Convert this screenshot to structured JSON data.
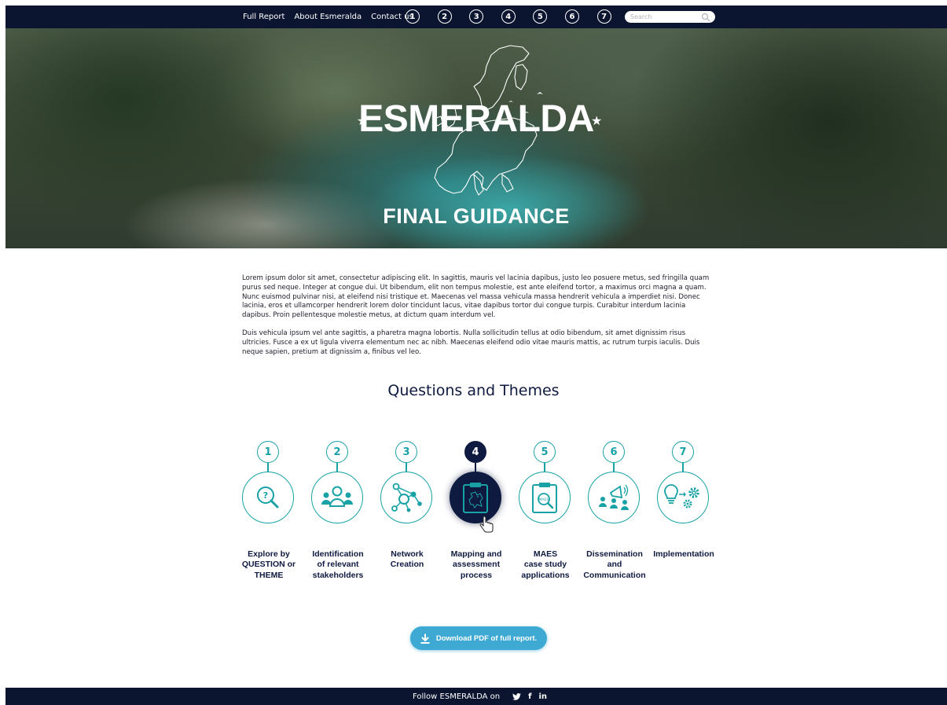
{
  "nav": {
    "links": [
      "Full Report",
      "About Esmeralda",
      "Contact us"
    ],
    "numbers": [
      "1",
      "2",
      "3",
      "4",
      "5",
      "6",
      "7"
    ],
    "search_placeholder": "Search"
  },
  "hero": {
    "title": "ESMERALDA",
    "subtitle": "FINAL GUIDANCE"
  },
  "intro": {
    "paragraphs": [
      "Lorem ipsum dolor sit amet, consectetur adipiscing elit. In sagittis, mauris vel lacinia dapibus, justo leo posuere metus, sed fringilla quam purus sed neque. Integer at congue dui. Ut bibendum, elit non tempus molestie, est ante eleifend tortor, a maximus orci magna a quam. Nunc euismod pulvinar nisi, at eleifend nisi tristique et. Maecenas vel massa vehicula massa hendrerit vehicula a imperdiet nisi. Donec lacinia, eros et ullamcorper hendrerit lorem dolor tincidunt lacus, vitae dapibus tortor dui congue turpis. Curabitur interdum lacinia dapibus. Proin pellentesque molestie metus, at dictum quam interdum vel.",
      "Duis vehicula ipsum vel ante sagittis, a pharetra magna lobortis. Nulla sollicitudin tellus at odio bibendum, sit amet dignissim risus ultricies. Fusce a ex ut ligula viverra elementum nec ac nibh. Maecenas eleifend odio vitae mauris mattis, ac rutrum turpis iaculis. Duis neque sapien, pretium at dignissim a, finibus vel leo."
    ]
  },
  "section_title": "Questions and Themes",
  "themes": [
    {
      "num": "1",
      "label_lines": [
        "Explore by",
        "QUESTION or",
        "THEME"
      ],
      "icon": "question-search-icon",
      "active": false
    },
    {
      "num": "2",
      "label_lines": [
        "Identification",
        "of relevant",
        "stakeholders"
      ],
      "icon": "people-icon",
      "active": false
    },
    {
      "num": "3",
      "label_lines": [
        "Network",
        "Creation"
      ],
      "icon": "network-icon",
      "active": false
    },
    {
      "num": "4",
      "label_lines": [
        "Mapping and",
        "assessment",
        "process"
      ],
      "icon": "map-clipboard-icon",
      "active": true
    },
    {
      "num": "5",
      "label_lines": [
        "MAES",
        "case study",
        "applications"
      ],
      "icon": "case-study-clipboard-icon",
      "active": false
    },
    {
      "num": "6",
      "label_lines": [
        "Dissemination",
        "and",
        "Communication"
      ],
      "icon": "megaphone-people-icon",
      "active": false
    },
    {
      "num": "7",
      "label_lines": [
        "Implementation"
      ],
      "icon": "lightbulb-gear-icon",
      "active": false
    }
  ],
  "download": {
    "label": "Download PDF of full report."
  },
  "footer": {
    "follow": "Follow ESMERALDA on",
    "social": [
      {
        "icon": "twitter-icon",
        "glyph": ""
      },
      {
        "icon": "facebook-icon",
        "glyph": "f"
      },
      {
        "icon": "linkedin-icon",
        "glyph": "in"
      }
    ]
  },
  "colors": {
    "navy": "#0b1530",
    "teal": "#18a2a6",
    "button_blue": "#3eaad4",
    "active_navy": "#0f1a40"
  }
}
